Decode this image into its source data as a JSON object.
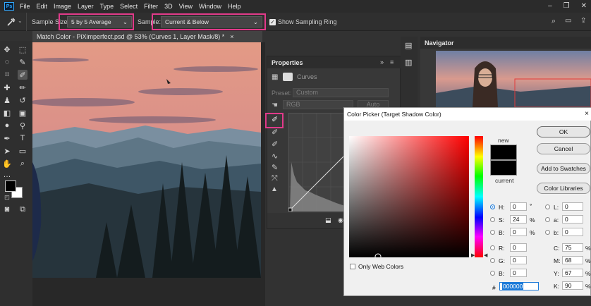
{
  "menubar": {
    "logo": "Ps",
    "items": [
      "File",
      "Edit",
      "Image",
      "Layer",
      "Type",
      "Select",
      "Filter",
      "3D",
      "View",
      "Window",
      "Help"
    ]
  },
  "options": {
    "sample_size_label": "Sample Size:",
    "sample_size_value": "5 by 5 Average",
    "sample_label": "Sample:",
    "sample_value": "Current & Below",
    "show_ring_label": "Show Sampling Ring",
    "show_ring_checked": true
  },
  "document": {
    "tab_title": "Match Color - PiXimperfect.psd @ 53% (Curves 1, Layer Mask/8) *",
    "close_glyph": "×"
  },
  "properties": {
    "title": "Properties",
    "header": "Curves",
    "preset_label": "Preset:",
    "preset_value": "Custom",
    "channel_value": "RGB",
    "auto_label": "Auto"
  },
  "navigator": {
    "title": "Navigator"
  },
  "color_picker": {
    "title": "Color Picker (Target Shadow Color)",
    "close_glyph": "×",
    "buttons": {
      "ok": "OK",
      "cancel": "Cancel",
      "add_swatches": "Add to Swatches",
      "color_libraries": "Color Libraries"
    },
    "new_label": "new",
    "current_label": "current",
    "only_web_colors": "Only Web Colors",
    "hsb": [
      {
        "label": "H:",
        "value": "0",
        "unit": "°"
      },
      {
        "label": "S:",
        "value": "24",
        "unit": "%"
      },
      {
        "label": "B:",
        "value": "0",
        "unit": "%"
      }
    ],
    "rgb": [
      {
        "label": "R:",
        "value": "0"
      },
      {
        "label": "G:",
        "value": "0"
      },
      {
        "label": "B:",
        "value": "0"
      }
    ],
    "lab": [
      {
        "label": "L:",
        "value": "0"
      },
      {
        "label": "a:",
        "value": "0"
      },
      {
        "label": "b:",
        "value": "0"
      }
    ],
    "cmyk": [
      {
        "label": "C:",
        "value": "75",
        "unit": "%"
      },
      {
        "label": "M:",
        "value": "68",
        "unit": "%"
      },
      {
        "label": "Y:",
        "value": "67",
        "unit": "%"
      },
      {
        "label": "K:",
        "value": "90",
        "unit": "%"
      }
    ],
    "hex_label": "#",
    "hex_value": "000000",
    "hue_color": "#ff0000",
    "new_color": "#000000",
    "current_color": "#000000"
  },
  "colors": {
    "highlight": "#e23a8a",
    "accent": "#31a8ff"
  }
}
